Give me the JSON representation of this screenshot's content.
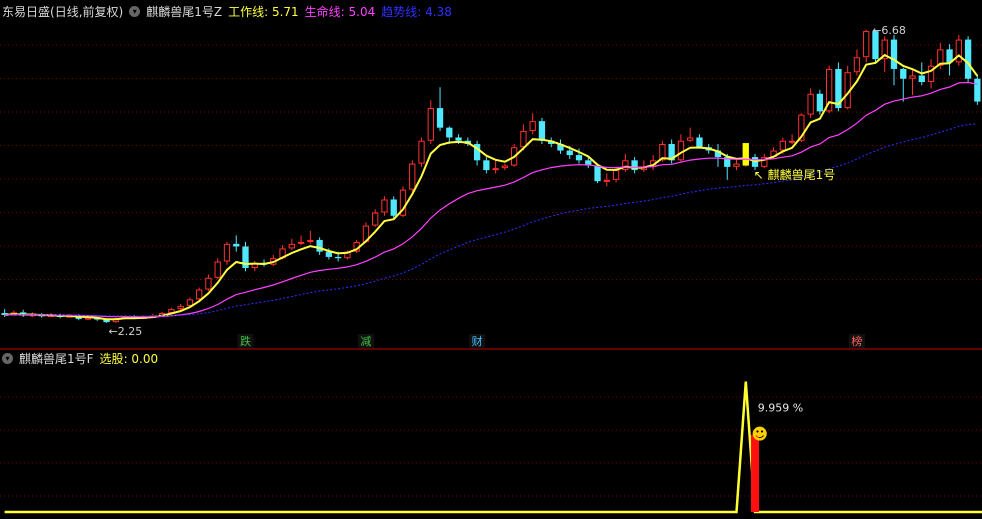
{
  "main_panel": {
    "stock_name": "东易日盛",
    "period_label": "(日线,前复权)",
    "indicator_name": "麒麟兽尾1号Z",
    "lines": [
      {
        "label": "工作线",
        "value": "5.71",
        "color": "#ffff40"
      },
      {
        "label": "生命线",
        "value": "5.04",
        "color": "#ff40ff"
      },
      {
        "label": "趋势线",
        "value": "4.38",
        "color": "#3030ff"
      }
    ],
    "high_label": "6.68",
    "low_label": "2.25",
    "signal_label": "麒麟兽尾1号",
    "markers": [
      {
        "text": "跌",
        "bar_index": 26,
        "color": "#40c040"
      },
      {
        "text": "减",
        "bar_index": 39,
        "color": "#40c040"
      },
      {
        "text": "财",
        "bar_index": 51,
        "color": "#40c0ff"
      },
      {
        "text": "榜",
        "bar_index": 92,
        "color": "#ff6060"
      }
    ]
  },
  "sub_panel": {
    "indicator_name": "麒麟兽尾1号F",
    "label": "选股",
    "value": "0.00",
    "peak_label": "9.959 %",
    "smiley_icon": "☻"
  },
  "colors": {
    "up": "#ff3030",
    "down": "#50e8ff",
    "grid": "#800000",
    "divider": "#c00000",
    "signal_bar": "#ffff00"
  },
  "chart_data": {
    "type": "candlestick",
    "ylim": [
      2.1,
      6.85
    ],
    "candles": [
      [
        2.36,
        2.33,
        2.42,
        2.3
      ],
      [
        2.33,
        2.37,
        2.4,
        2.31
      ],
      [
        2.37,
        2.32,
        2.41,
        2.3
      ],
      [
        2.32,
        2.34,
        2.37,
        2.3
      ],
      [
        2.34,
        2.31,
        2.36,
        2.29
      ],
      [
        2.31,
        2.33,
        2.36,
        2.3
      ],
      [
        2.33,
        2.3,
        2.35,
        2.28
      ],
      [
        2.3,
        2.32,
        2.35,
        2.29
      ],
      [
        2.32,
        2.27,
        2.34,
        2.25
      ],
      [
        2.27,
        2.29,
        2.31,
        2.25
      ],
      [
        2.29,
        2.26,
        2.3,
        2.24
      ],
      [
        2.26,
        2.22,
        2.27,
        2.21
      ],
      [
        2.22,
        2.27,
        2.29,
        2.21
      ],
      [
        2.27,
        2.31,
        2.33,
        2.26
      ],
      [
        2.31,
        2.28,
        2.33,
        2.27
      ],
      [
        2.28,
        2.3,
        2.32,
        2.27
      ],
      [
        2.3,
        2.32,
        2.35,
        2.29
      ],
      [
        2.32,
        2.36,
        2.38,
        2.31
      ],
      [
        2.36,
        2.42,
        2.44,
        2.34
      ],
      [
        2.42,
        2.47,
        2.5,
        2.4
      ],
      [
        2.47,
        2.57,
        2.6,
        2.45
      ],
      [
        2.57,
        2.72,
        2.75,
        2.55
      ],
      [
        2.72,
        2.9,
        2.95,
        2.7
      ],
      [
        2.9,
        3.15,
        3.2,
        2.88
      ],
      [
        3.15,
        3.42,
        3.45,
        3.1
      ],
      [
        3.42,
        3.38,
        3.55,
        3.3
      ],
      [
        3.38,
        3.05,
        3.45,
        3.0
      ],
      [
        3.05,
        3.13,
        3.16,
        3.0
      ],
      [
        3.13,
        3.1,
        3.18,
        3.07
      ],
      [
        3.1,
        3.2,
        3.25,
        3.08
      ],
      [
        3.2,
        3.35,
        3.4,
        3.18
      ],
      [
        3.35,
        3.42,
        3.5,
        3.33
      ],
      [
        3.42,
        3.45,
        3.55,
        3.4
      ],
      [
        3.45,
        3.48,
        3.62,
        3.42
      ],
      [
        3.48,
        3.3,
        3.52,
        3.25
      ],
      [
        3.3,
        3.22,
        3.35,
        3.18
      ],
      [
        3.22,
        3.2,
        3.3,
        3.15
      ],
      [
        3.2,
        3.3,
        3.32,
        3.18
      ],
      [
        3.3,
        3.45,
        3.48,
        3.28
      ],
      [
        3.45,
        3.7,
        3.75,
        3.43
      ],
      [
        3.7,
        3.9,
        3.95,
        3.68
      ],
      [
        3.9,
        4.1,
        4.15,
        3.85
      ],
      [
        4.1,
        3.85,
        4.15,
        3.8
      ],
      [
        3.85,
        4.25,
        4.3,
        3.83
      ],
      [
        4.25,
        4.65,
        4.7,
        4.22
      ],
      [
        4.65,
        5.0,
        5.05,
        4.6
      ],
      [
        5.0,
        5.5,
        5.62,
        4.95
      ],
      [
        5.5,
        5.2,
        5.82,
        5.15
      ],
      [
        5.2,
        5.05,
        5.22,
        4.95
      ],
      [
        5.05,
        5.0,
        5.1,
        4.95
      ],
      [
        5.0,
        4.95,
        5.05,
        4.92
      ],
      [
        4.95,
        4.7,
        5.0,
        4.62
      ],
      [
        4.7,
        4.55,
        4.75,
        4.5
      ],
      [
        4.55,
        4.58,
        4.7,
        4.5
      ],
      [
        4.58,
        4.62,
        4.65,
        4.55
      ],
      [
        4.62,
        4.9,
        4.95,
        4.6
      ],
      [
        4.9,
        5.15,
        5.25,
        4.85
      ],
      [
        5.15,
        5.3,
        5.42,
        5.1
      ],
      [
        5.3,
        5.0,
        5.35,
        4.95
      ],
      [
        5.0,
        4.95,
        5.05,
        4.9
      ],
      [
        4.95,
        4.85,
        5.02,
        4.8
      ],
      [
        4.85,
        4.78,
        4.92,
        4.72
      ],
      [
        4.78,
        4.7,
        4.88,
        4.65
      ],
      [
        4.7,
        4.62,
        4.76,
        4.58
      ],
      [
        4.62,
        4.38,
        4.65,
        4.35
      ],
      [
        4.38,
        4.4,
        4.5,
        4.3
      ],
      [
        4.4,
        4.55,
        4.58,
        4.36
      ],
      [
        4.55,
        4.7,
        4.8,
        4.52
      ],
      [
        4.7,
        4.55,
        4.75,
        4.5
      ],
      [
        4.55,
        4.6,
        4.7,
        4.52
      ],
      [
        4.6,
        4.7,
        4.78,
        4.55
      ],
      [
        4.7,
        4.95,
        5.0,
        4.68
      ],
      [
        4.95,
        4.7,
        5.02,
        4.65
      ],
      [
        4.7,
        5.0,
        5.1,
        4.68
      ],
      [
        5.0,
        5.05,
        5.2,
        4.98
      ],
      [
        5.05,
        4.9,
        5.1,
        4.88
      ],
      [
        4.9,
        4.85,
        4.95,
        4.8
      ],
      [
        4.85,
        4.75,
        4.95,
        4.6
      ],
      [
        4.75,
        4.6,
        4.8,
        4.4
      ],
      [
        4.6,
        4.65,
        4.72,
        4.55
      ],
      [
        4.65,
        4.75,
        4.82,
        4.6
      ],
      [
        4.75,
        4.6,
        4.8,
        4.55
      ],
      [
        4.6,
        4.75,
        4.8,
        4.58
      ],
      [
        4.75,
        4.85,
        4.9,
        4.72
      ],
      [
        4.85,
        5.0,
        5.05,
        4.8
      ],
      [
        5.0,
        5.0,
        5.1,
        4.95
      ],
      [
        5.0,
        5.4,
        5.42,
        4.98
      ],
      [
        5.4,
        5.72,
        5.8,
        5.35
      ],
      [
        5.72,
        5.45,
        5.78,
        5.4
      ],
      [
        5.45,
        6.1,
        6.15,
        5.42
      ],
      [
        6.1,
        5.5,
        6.2,
        5.45
      ],
      [
        5.5,
        6.05,
        6.15,
        5.48
      ],
      [
        6.05,
        6.28,
        6.4,
        6.0
      ],
      [
        6.28,
        6.68,
        6.7,
        6.2
      ],
      [
        6.68,
        6.25,
        6.7,
        6.2
      ],
      [
        6.25,
        6.55,
        6.6,
        6.05
      ],
      [
        6.55,
        6.1,
        6.62,
        5.85
      ],
      [
        6.1,
        5.95,
        6.12,
        5.6
      ],
      [
        5.95,
        6.0,
        6.1,
        5.7
      ],
      [
        6.0,
        5.9,
        6.2,
        5.85
      ],
      [
        5.9,
        6.15,
        6.25,
        5.8
      ],
      [
        6.15,
        6.4,
        6.5,
        6.1
      ],
      [
        6.4,
        6.2,
        6.48,
        6.0
      ],
      [
        6.2,
        6.55,
        6.62,
        6.15
      ],
      [
        6.55,
        5.95,
        6.6,
        5.9
      ],
      [
        5.95,
        5.6,
        6.0,
        5.55
      ]
    ],
    "signal_bar_index": 80,
    "sub_indicator": {
      "ylim": [
        0,
        11
      ],
      "line": [
        0,
        0,
        0,
        0,
        0,
        0,
        0,
        0,
        0,
        0,
        0,
        0,
        0,
        0,
        0,
        0,
        0,
        0,
        0,
        0,
        0,
        0,
        0,
        0,
        0,
        0,
        0,
        0,
        0,
        0,
        0,
        0,
        0,
        0,
        0,
        0,
        0,
        0,
        0,
        0,
        0,
        0,
        0,
        0,
        0,
        0,
        0,
        0,
        0,
        0,
        0,
        0,
        0,
        0,
        0,
        0,
        0,
        0,
        0,
        0,
        0,
        0,
        0,
        0,
        0,
        0,
        0,
        0,
        0,
        0,
        0,
        0,
        0,
        0,
        0,
        0,
        0,
        0,
        0,
        0,
        9.959,
        0,
        0,
        0,
        0,
        0,
        0,
        0,
        0,
        0,
        0,
        0,
        0,
        0,
        0,
        0,
        0,
        0,
        0,
        0,
        0,
        0,
        0,
        0,
        0,
        0,
        0,
        0
      ],
      "bar_index": 81,
      "bar_value": 5.9
    }
  }
}
